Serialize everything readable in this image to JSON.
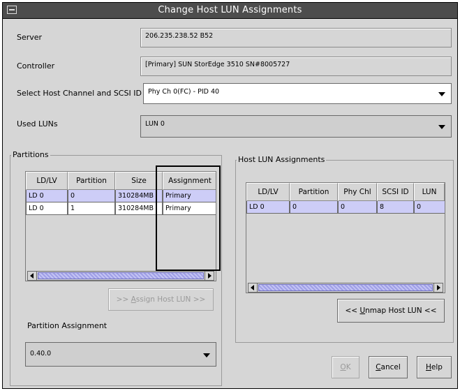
{
  "window": {
    "title": "Change Host LUN Assignments"
  },
  "server": {
    "label": "Server",
    "value": "206.235.238.52 B52"
  },
  "controller": {
    "label": "Controller",
    "value": "[Primary] SUN StorEdge 3510 SN#8005727"
  },
  "host_channel": {
    "label": "Select Host Channel and SCSI ID",
    "value": "Phy Ch 0(FC) - PID 40"
  },
  "used_luns": {
    "label": "Used LUNs",
    "value": "LUN 0"
  },
  "partitions": {
    "title": "Partitions",
    "columns": [
      "LD/LV",
      "Partition",
      "Size",
      "Assignment"
    ],
    "rows": [
      [
        "LD 0",
        "0",
        "310284MB",
        "Primary"
      ],
      [
        "LD 0",
        "1",
        "310284MB",
        "Primary"
      ]
    ]
  },
  "host_lun_assignments": {
    "title": "Host LUN Assignments",
    "columns": [
      "LD/LV",
      "Partition",
      "Phy Chl",
      "SCSI ID",
      "LUN"
    ],
    "rows": [
      [
        "LD 0",
        "0",
        "0",
        "8",
        "0"
      ]
    ]
  },
  "assign_button": {
    "prefix": ">> ",
    "mnemonic": "A",
    "rest": "ssign Host LUN >>"
  },
  "unmap_button": {
    "prefix": "<< ",
    "mnemonic": "U",
    "rest": "nmap Host LUN <<"
  },
  "partition_assignment": {
    "label": "Partition Assignment",
    "value": "0.40.0"
  },
  "footer": {
    "ok": {
      "mnemonic": "O",
      "rest": "K"
    },
    "cancel": {
      "mnemonic": "C",
      "rest": "ancel"
    },
    "help": {
      "mnemonic": "H",
      "rest": "elp"
    }
  },
  "colors": {
    "titlebar": "#4d4d4d",
    "selection": "#cdcdf7",
    "background": "#d6d6d6"
  }
}
